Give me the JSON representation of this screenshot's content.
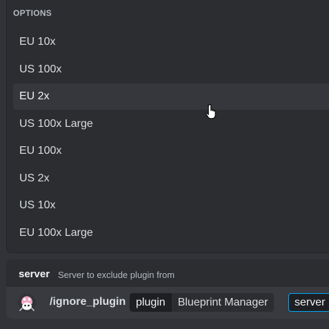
{
  "autocomplete": {
    "header": "OPTIONS",
    "options": [
      {
        "label": "EU 10x"
      },
      {
        "label": "US 100x"
      },
      {
        "label": "EU 2x"
      },
      {
        "label": "US 100x Large"
      },
      {
        "label": "EU 100x"
      },
      {
        "label": "US 2x"
      },
      {
        "label": "US 10x"
      },
      {
        "label": "EU 100x Large"
      }
    ],
    "selected_option": "EU 2x"
  },
  "argument_hint": {
    "name": "server",
    "description": "Server to exclude plugin from"
  },
  "command_input": {
    "bot_icon": "bot-avatar-icon",
    "command": "/ignore_plugin",
    "params": [
      {
        "key": "plugin",
        "value": "Blueprint Manager"
      }
    ],
    "active_param": "server"
  },
  "colors": {
    "background": "#313338",
    "popover": "#2b2d31",
    "selected_row": "#35373c",
    "focus_border": "#00a8fc"
  }
}
